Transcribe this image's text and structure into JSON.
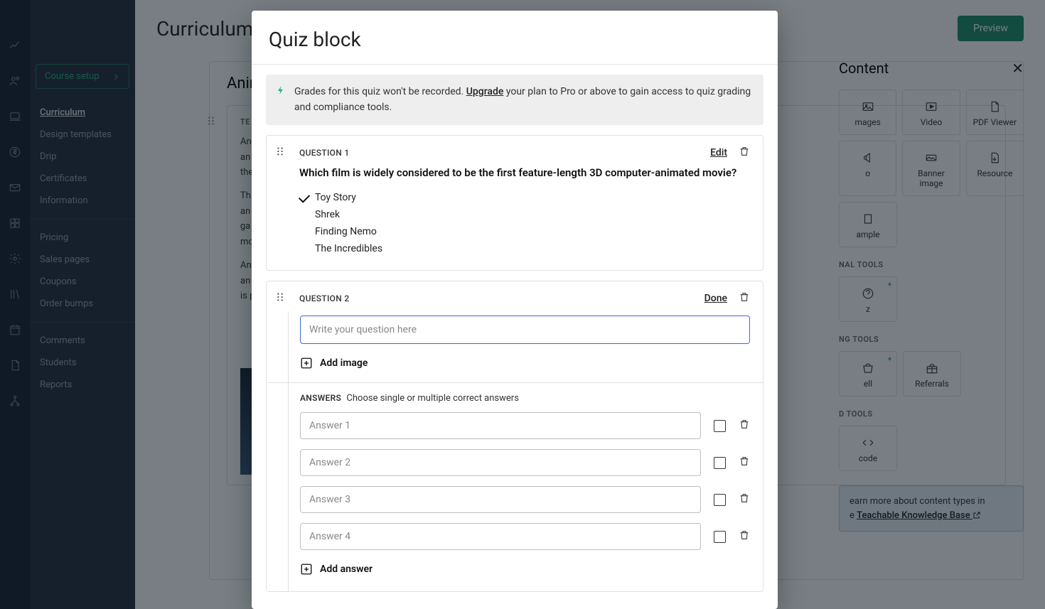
{
  "page": {
    "title": "Curriculum",
    "preview_label": "Preview"
  },
  "sidebar": {
    "top_text_1": "",
    "top_text_2": "",
    "course_setup": "Course setup",
    "items": [
      "Curriculum",
      "Design templates",
      "Drip",
      "Certificates",
      "Information"
    ],
    "items2": [
      "Pricing",
      "Sales pages",
      "Coupons",
      "Order bumps"
    ],
    "items3": [
      "Comments",
      "Students",
      "Reports"
    ]
  },
  "editor": {
    "lesson_title": "Anim",
    "tb_label": "TE",
    "p1": "An",
    "p1b": "an",
    "p1c": "the",
    "p2": "Th",
    "p2b": "an",
    "p2c": "ga",
    "p2d": "mo",
    "p3": "An",
    "p3b": "an",
    "p3c": "is p"
  },
  "content_panel": {
    "title": "Content",
    "tiles_row1": [
      "mages",
      "Video",
      "PDF Viewer"
    ],
    "tiles_row2": [
      "o",
      "Banner image",
      "Resource"
    ],
    "tiles_row3": [
      "ample"
    ],
    "section2": "NAL TOOLS",
    "tiles2": [
      "z"
    ],
    "section3": "NG TOOLS",
    "tiles3": [
      "ell",
      "Referrals"
    ],
    "section4": "D TOOLS",
    "tiles4": [
      "code"
    ],
    "kb_text1": "earn more about content types in",
    "kb_text2": "e ",
    "kb_link": "Teachable Knowledge Base"
  },
  "modal": {
    "title": "Quiz block",
    "upgrade": {
      "pre": "Grades for this quiz won't be recorded. ",
      "link": "Upgrade",
      "post": " your plan to Pro or above to gain access to quiz grading and compliance tools."
    },
    "q1": {
      "label": "QUESTION 1",
      "edit": "Edit",
      "text": "Which film is widely considered to be the first feature-length 3D computer-animated movie?",
      "opts": [
        "Toy Story",
        "Shrek",
        "Finding Nemo",
        "The Incredibles"
      ]
    },
    "q2": {
      "label": "QUESTION 2",
      "done": "Done",
      "placeholder": "Write your question here",
      "add_image": "Add image",
      "answers_label": "ANSWERS",
      "answers_hint": "Choose single or multiple correct answers",
      "ans_ph": [
        "Answer 1",
        "Answer 2",
        "Answer 3",
        "Answer 4"
      ],
      "add_answer": "Add answer"
    }
  }
}
